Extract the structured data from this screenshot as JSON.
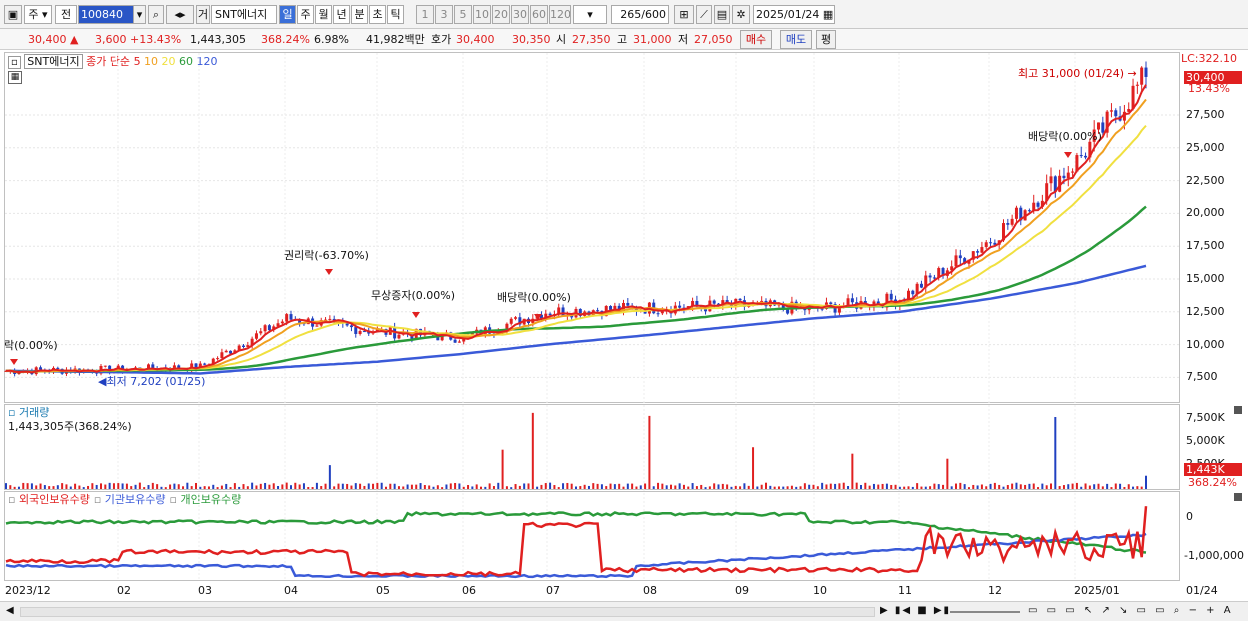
{
  "toolbar": {
    "type_label": "주",
    "market_label": "전",
    "code": "100840",
    "stock_kind": "거",
    "stock_name": "SNT에너지",
    "periods": [
      "일",
      "주",
      "월",
      "년",
      "분",
      "초",
      "틱"
    ],
    "intervals": [
      "1",
      "3",
      "5",
      "10",
      "20",
      "30",
      "60",
      "120"
    ],
    "count": "265",
    "count_total": "/600",
    "date": "2025/01/24"
  },
  "quote": {
    "price": "30,400",
    "arrow": "▲",
    "change": "3,600",
    "change_pct": "+13.43%",
    "volume": "1,443,305",
    "volume_pct": "368.24%",
    "turnover": "6.98%",
    "amount": "41,982백만",
    "bid_label": "호가",
    "ask": "30,400",
    "bid": "30,350",
    "open_label": "시",
    "open": "27,350",
    "high_label": "고",
    "high": "31,000",
    "low_label": "저",
    "low": "27,050",
    "buy_label": "매수",
    "sell_label": "매도",
    "eval_label": "평"
  },
  "legend": {
    "name": "SNT에너지",
    "series_label": "종가 단순",
    "ma": [
      "5",
      "10",
      "20",
      "60",
      "120"
    ],
    "ma_colors": [
      "#e02020",
      "#f0a020",
      "#f0e040",
      "#2a9a3a",
      "#3a5ad8"
    ]
  },
  "price_pane": {
    "lc_label": "LC:322.10",
    "last_price": "30,400",
    "last_pct": "13.43%",
    "y_ticks": [
      "27,500",
      "25,000",
      "22,500",
      "20,000",
      "17,500",
      "15,000",
      "12,500",
      "10,000",
      "7,500"
    ],
    "annotations": {
      "high": "최고 31,000 (01/24)",
      "low": "최저 7,202 (01/25)",
      "rights": "권리락(-63.70%)",
      "bonus": "무상증자(0.00%)",
      "div1": "배당락(0.00%)",
      "div2": "배당락(0.00%)",
      "left_cut": "락(0.00%)"
    }
  },
  "volume_pane": {
    "title": "거래량",
    "value": "1,443,305주(368.24%)",
    "y_ticks": [
      "7,500K",
      "5,000K",
      "2,500K"
    ],
    "last": "1,443K",
    "last_pct": "368.24%"
  },
  "holding_pane": {
    "series": [
      "외국인보유수량",
      "기관보유수량",
      "개인보유수량"
    ],
    "colors": [
      "#e02020",
      "#3a5ad8",
      "#2a9a3a"
    ],
    "y_ticks": [
      "0",
      "-1,000,000"
    ]
  },
  "x_axis": {
    "labels": [
      "2023/12",
      "02",
      "03",
      "04",
      "05",
      "06",
      "07",
      "08",
      "09",
      "10",
      "11",
      "12",
      "2025/01"
    ],
    "right_label": "01/24"
  },
  "chart_data": {
    "type": "line",
    "title": "SNT에너지",
    "x": [
      "2023/12",
      "2024/02",
      "2024/03",
      "2024/04",
      "2024/05",
      "2024/06",
      "2024/07",
      "2024/08",
      "2024/09",
      "2024/10",
      "2024/11",
      "2024/12",
      "2025/01",
      "2025/01/24"
    ],
    "series": [
      {
        "name": "종가",
        "values": [
          8000,
          8100,
          8300,
          12000,
          11000,
          10500,
          12500,
          12800,
          13000,
          12700,
          13500,
          18000,
          24000,
          30400
        ]
      },
      {
        "name": "120",
        "values": [
          8000,
          7900,
          7800,
          8300,
          8700,
          9300,
          10000,
          10700,
          11400,
          12000,
          12500,
          13500,
          14700,
          16000
        ]
      }
    ],
    "ylim": [
      6500,
      32000
    ],
    "high": {
      "value": 31000,
      "date": "01/24"
    },
    "low": {
      "value": 7202,
      "date": "01/25"
    },
    "volume_last": 1443305,
    "volume_pct": 368.24
  }
}
